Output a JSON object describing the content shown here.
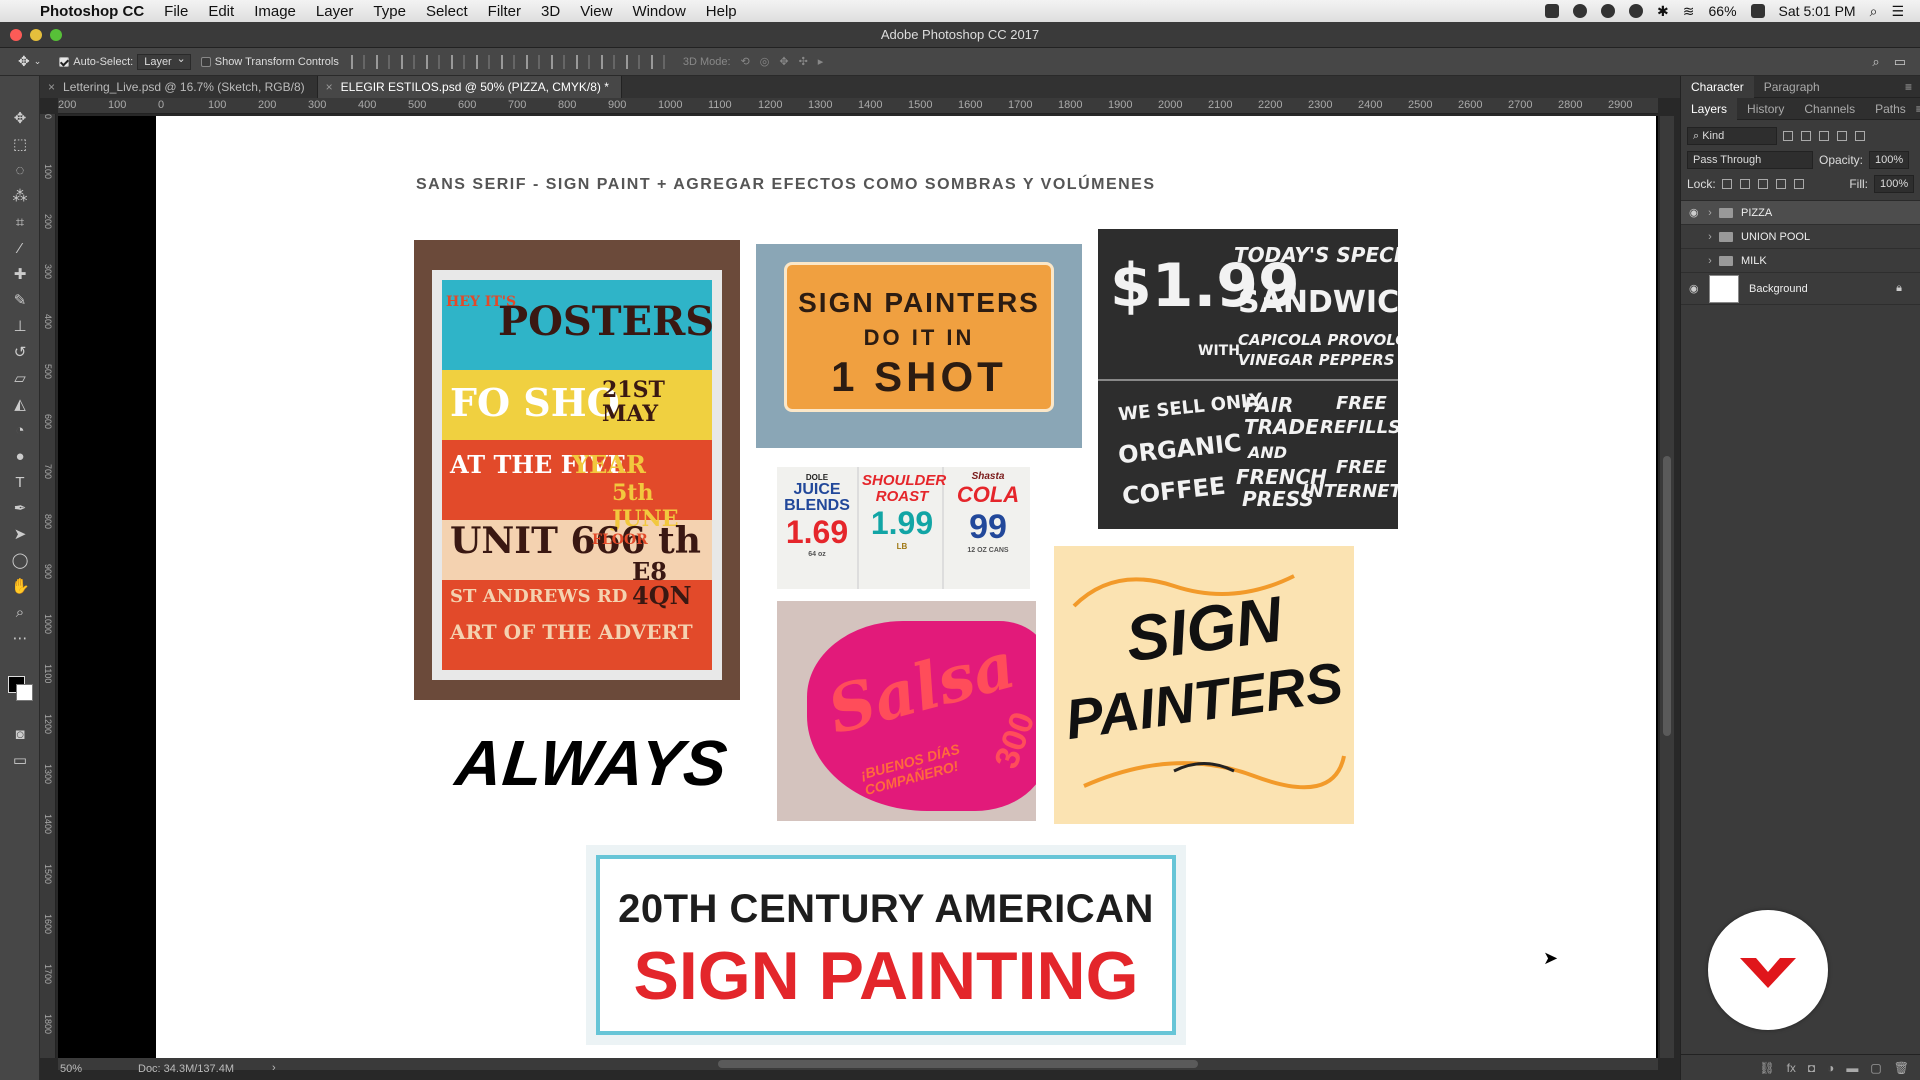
{
  "menubar": {
    "app_name": "Photoshop CC",
    "items": [
      "File",
      "Edit",
      "Image",
      "Layer",
      "Type",
      "Select",
      "Filter",
      "3D",
      "View",
      "Window",
      "Help"
    ],
    "status": {
      "battery": "66%",
      "clock": "Sat 5:01 PM"
    }
  },
  "window": {
    "title": "Adobe Photoshop CC 2017"
  },
  "options_bar": {
    "auto_select_label": "Auto-Select:",
    "auto_select_checked": true,
    "auto_select_target": "Layer",
    "show_transform_label": "Show Transform Controls",
    "show_transform_checked": false,
    "mode_3d_label": "3D Mode:"
  },
  "doc_tabs": [
    {
      "label": "Lettering_Live.psd @ 16.7% (Sketch, RGB/8)",
      "active": false
    },
    {
      "label": "ELEGIR ESTILOS.psd @ 50% (PIZZA, CMYK/8) *",
      "active": true
    }
  ],
  "ruler_top": [
    "200",
    "100",
    "0",
    "100",
    "200",
    "300",
    "400",
    "500",
    "600",
    "700",
    "800",
    "900",
    "1000",
    "1100",
    "1200",
    "1300",
    "1400",
    "1500",
    "1600",
    "1700",
    "1800",
    "1900",
    "2000",
    "2100",
    "2200",
    "2300",
    "2400",
    "2500",
    "2600",
    "2700",
    "2800",
    "2900"
  ],
  "ruler_left": [
    "0",
    "100",
    "200",
    "300",
    "400",
    "500",
    "600",
    "700",
    "800",
    "900",
    "1000",
    "1100",
    "1200",
    "1300",
    "1400",
    "1500",
    "1600",
    "1700",
    "1800"
  ],
  "canvas": {
    "heading": "SANS SERIF - SIGN PAINT + AGREGAR EFECTOS COMO SOMBRAS Y VOLÚMENES",
    "poster": {
      "lines": [
        "HEY IT'S",
        "POSTERS",
        "FO SHO",
        "21ST MAY",
        "AT THE FIVE",
        "YEAR",
        "5th JUNE",
        "UNIT 666 th",
        "FLOOR",
        "E8 4QN",
        "ST ANDREWS RD",
        "ART OF THE ADVERT"
      ]
    },
    "sign1": {
      "l1": "SIGN PAINTERS",
      "l2": "DO IT IN",
      "l3": "1 SHOT"
    },
    "chalk": {
      "price": "$1.99",
      "special": "TODAY'S SPECIAL",
      "sandwich": "SANDWICH",
      "with": "WITH",
      "ingredients1": "CAPICOLA PROVOLONE",
      "ingredients2": "VINEGAR PEPPERS",
      "we_sell": "WE SELL ONLY",
      "organic": "ORGANIC",
      "coffee": "COFFEE",
      "fair": "FAIR",
      "trade": "TRADE",
      "and": "AND",
      "french": "FRENCH",
      "press": "PRESS",
      "free1": "FREE",
      "refills": "REFILLS",
      "free2": "FREE",
      "internet": "INTERNET"
    },
    "tags": [
      {
        "brand": "DOLE",
        "name": "JUICE BLENDS",
        "price": "1.69",
        "unit": "64 oz"
      },
      {
        "brand": "",
        "name": "SHOULDER ROAST",
        "price": "1.99",
        "unit": "LB"
      },
      {
        "brand": "Shasta",
        "name": "COLA",
        "price": "99",
        "unit": "12 OZ CANS"
      }
    ],
    "salsa": {
      "word": "Salsa",
      "sub": "¡BUENOS DÍAS COMPAÑERO!",
      "num": "300"
    },
    "sign2": {
      "l1": "SIGN",
      "l2": "PAINTERS"
    },
    "always": "ALWAYS",
    "banner": {
      "l1": "20TH CENTURY AMERICAN",
      "l2": "SIGN PAINTING"
    }
  },
  "status_bar": {
    "zoom": "50%",
    "doc": "Doc: 34.3M/137.4M"
  },
  "right_panel": {
    "top_tabs": [
      "Character",
      "Paragraph"
    ],
    "tabs": [
      "Layers",
      "History",
      "Channels",
      "Paths"
    ],
    "filter_kind": "Kind",
    "blend_mode": "Pass Through",
    "opacity_label": "Opacity:",
    "opacity": "100%",
    "lock_label": "Lock:",
    "fill_label": "Fill:",
    "fill": "100%",
    "layers": [
      {
        "name": "PIZZA",
        "type": "group",
        "visible": true,
        "selected": true
      },
      {
        "name": "UNION POOL",
        "type": "group",
        "visible": false,
        "selected": false
      },
      {
        "name": "MILK",
        "type": "group",
        "visible": false,
        "selected": false
      },
      {
        "name": "Background",
        "type": "pixel",
        "visible": true,
        "selected": false,
        "locked": true
      }
    ]
  },
  "colors": {
    "accent_red": "#e3262b",
    "banner_blue": "#67c5d7",
    "chalk_bg": "#2d2d2d"
  }
}
